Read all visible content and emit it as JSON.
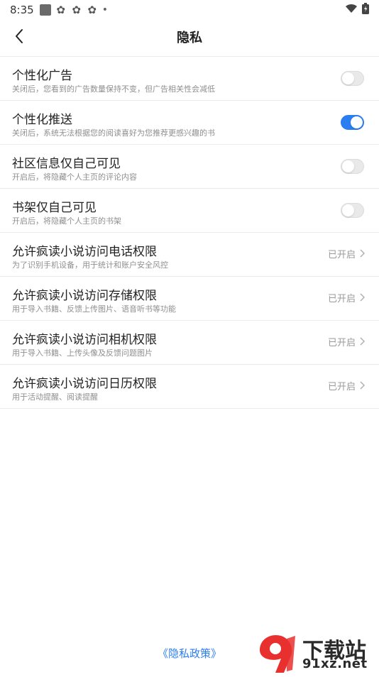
{
  "status_bar": {
    "time": "8:35"
  },
  "header": {
    "title": "隐私"
  },
  "settings": [
    {
      "label": "个性化广告",
      "desc": "关闭后，您看到的广告数量保持不变，但广告相关性会减低",
      "control": "toggle",
      "on": false
    },
    {
      "label": "个性化推送",
      "desc": "关闭后，系统无法根据您的阅读喜好为您推荐更感兴趣的书",
      "control": "toggle",
      "on": true
    },
    {
      "label": "社区信息仅自己可见",
      "desc": "开启后，将隐藏个人主页的评论内容",
      "control": "toggle",
      "on": false
    },
    {
      "label": "书架仅自己可见",
      "desc": "开启后，将隐藏个人主页的书架",
      "control": "toggle",
      "on": false
    },
    {
      "label": "允许疯读小说访问电话权限",
      "desc": "为了识别手机设备，用于统计和账户安全风控",
      "control": "link",
      "status": "已开启"
    },
    {
      "label": "允许疯读小说访问存储权限",
      "desc": "用于导入书籍、反馈上传图片、语音听书等功能",
      "control": "link",
      "status": "已开启"
    },
    {
      "label": "允许疯读小说访问相机权限",
      "desc": "用于导入书籍、上传头像及反馈问题图片",
      "control": "link",
      "status": "已开启"
    },
    {
      "label": "允许疯读小说访问日历权限",
      "desc": "用于活动提醒、阅读提醒",
      "control": "link",
      "status": "已开启"
    }
  ],
  "footer": {
    "policy_link": "《隐私政策》"
  },
  "watermark": {
    "main_text": "下载站",
    "sub_text": "91xz.net"
  },
  "colors": {
    "accent": "#2b7ef2",
    "toggle_off": "#e9e9e9",
    "divider": "#ececec",
    "watermark_red": "#e8312f"
  },
  "icons": {
    "back": "chevron-left-icon",
    "row_arrow": "chevron-right-icon",
    "wifi": "wifi-icon",
    "battery": "battery-icon"
  }
}
